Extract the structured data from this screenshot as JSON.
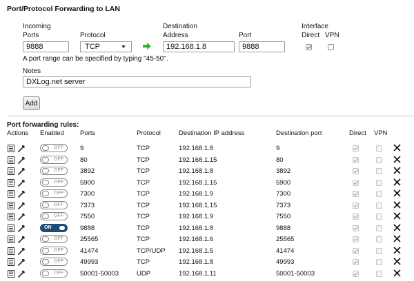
{
  "form": {
    "title": "Port/Protocol Forwarding to LAN",
    "incoming_label": "Incoming",
    "ports_label": "Ports",
    "ports_value": "9888",
    "protocol_label": "Protocol",
    "protocol_value": "TCP",
    "destination_label": "Destination",
    "address_label": "Address",
    "address_value": "192.168.1.8",
    "port_label": "Port",
    "port_value": "9888",
    "interface_label": "Interface",
    "direct_label": "Direct",
    "vpn_label": "VPN",
    "direct_checked": true,
    "vpn_checked": false,
    "hint": "A port range can be specified by typing \"45-50\".",
    "notes_label": "Notes",
    "notes_value": "DXLog.net server",
    "add_button": "Add"
  },
  "rules": {
    "title": "Port forwarding rules:",
    "headers": {
      "actions": "Actions",
      "enabled": "Enabled",
      "ports": "Ports",
      "protocol": "Protocol",
      "dest_ip": "Destination IP address",
      "dest_port": "Destination port",
      "direct": "Direct",
      "vpn": "VPN"
    },
    "toggle_on": "ON",
    "toggle_off": "OFF",
    "rows": [
      {
        "enabled": false,
        "ports": "9",
        "protocol": "TCP",
        "ip": "192.168.1.8",
        "dport": "9",
        "direct": true,
        "vpn": false
      },
      {
        "enabled": false,
        "ports": "80",
        "protocol": "TCP",
        "ip": "192.168.1.15",
        "dport": "80",
        "direct": true,
        "vpn": false
      },
      {
        "enabled": false,
        "ports": "3892",
        "protocol": "TCP",
        "ip": "192.168.1.8",
        "dport": "3892",
        "direct": true,
        "vpn": false
      },
      {
        "enabled": false,
        "ports": "5900",
        "protocol": "TCP",
        "ip": "192.168.1.15",
        "dport": "5900",
        "direct": true,
        "vpn": false
      },
      {
        "enabled": false,
        "ports": "7300",
        "protocol": "TCP",
        "ip": "192.168.1.9",
        "dport": "7300",
        "direct": true,
        "vpn": false
      },
      {
        "enabled": false,
        "ports": "7373",
        "protocol": "TCP",
        "ip": "192.168.1.15",
        "dport": "7373",
        "direct": true,
        "vpn": false
      },
      {
        "enabled": false,
        "ports": "7550",
        "protocol": "TCP",
        "ip": "192.168.1.9",
        "dport": "7550",
        "direct": true,
        "vpn": false
      },
      {
        "enabled": true,
        "ports": "9888",
        "protocol": "TCP",
        "ip": "192.168.1.8",
        "dport": "9888",
        "direct": true,
        "vpn": false
      },
      {
        "enabled": false,
        "ports": "25565",
        "protocol": "TCP",
        "ip": "192.168.1.6",
        "dport": "25565",
        "direct": true,
        "vpn": false
      },
      {
        "enabled": false,
        "ports": "41474",
        "protocol": "TCP/UDP",
        "ip": "192.168.1.5",
        "dport": "41474",
        "direct": true,
        "vpn": false
      },
      {
        "enabled": false,
        "ports": "49993",
        "protocol": "TCP",
        "ip": "192.168.1.8",
        "dport": "49993",
        "direct": true,
        "vpn": false
      },
      {
        "enabled": false,
        "ports": "50001-50003",
        "protocol": "UDP",
        "ip": "192.168.1.11",
        "dport": "50001-50003",
        "direct": true,
        "vpn": false
      }
    ]
  },
  "colors": {
    "toggle_on": "#1c4b78",
    "arrow": "#2db92d"
  },
  "icons": {
    "arrow": "right-arrow-icon",
    "edit": "notes-icon",
    "wrench": "wrench-icon",
    "delete": "close-x-icon"
  }
}
